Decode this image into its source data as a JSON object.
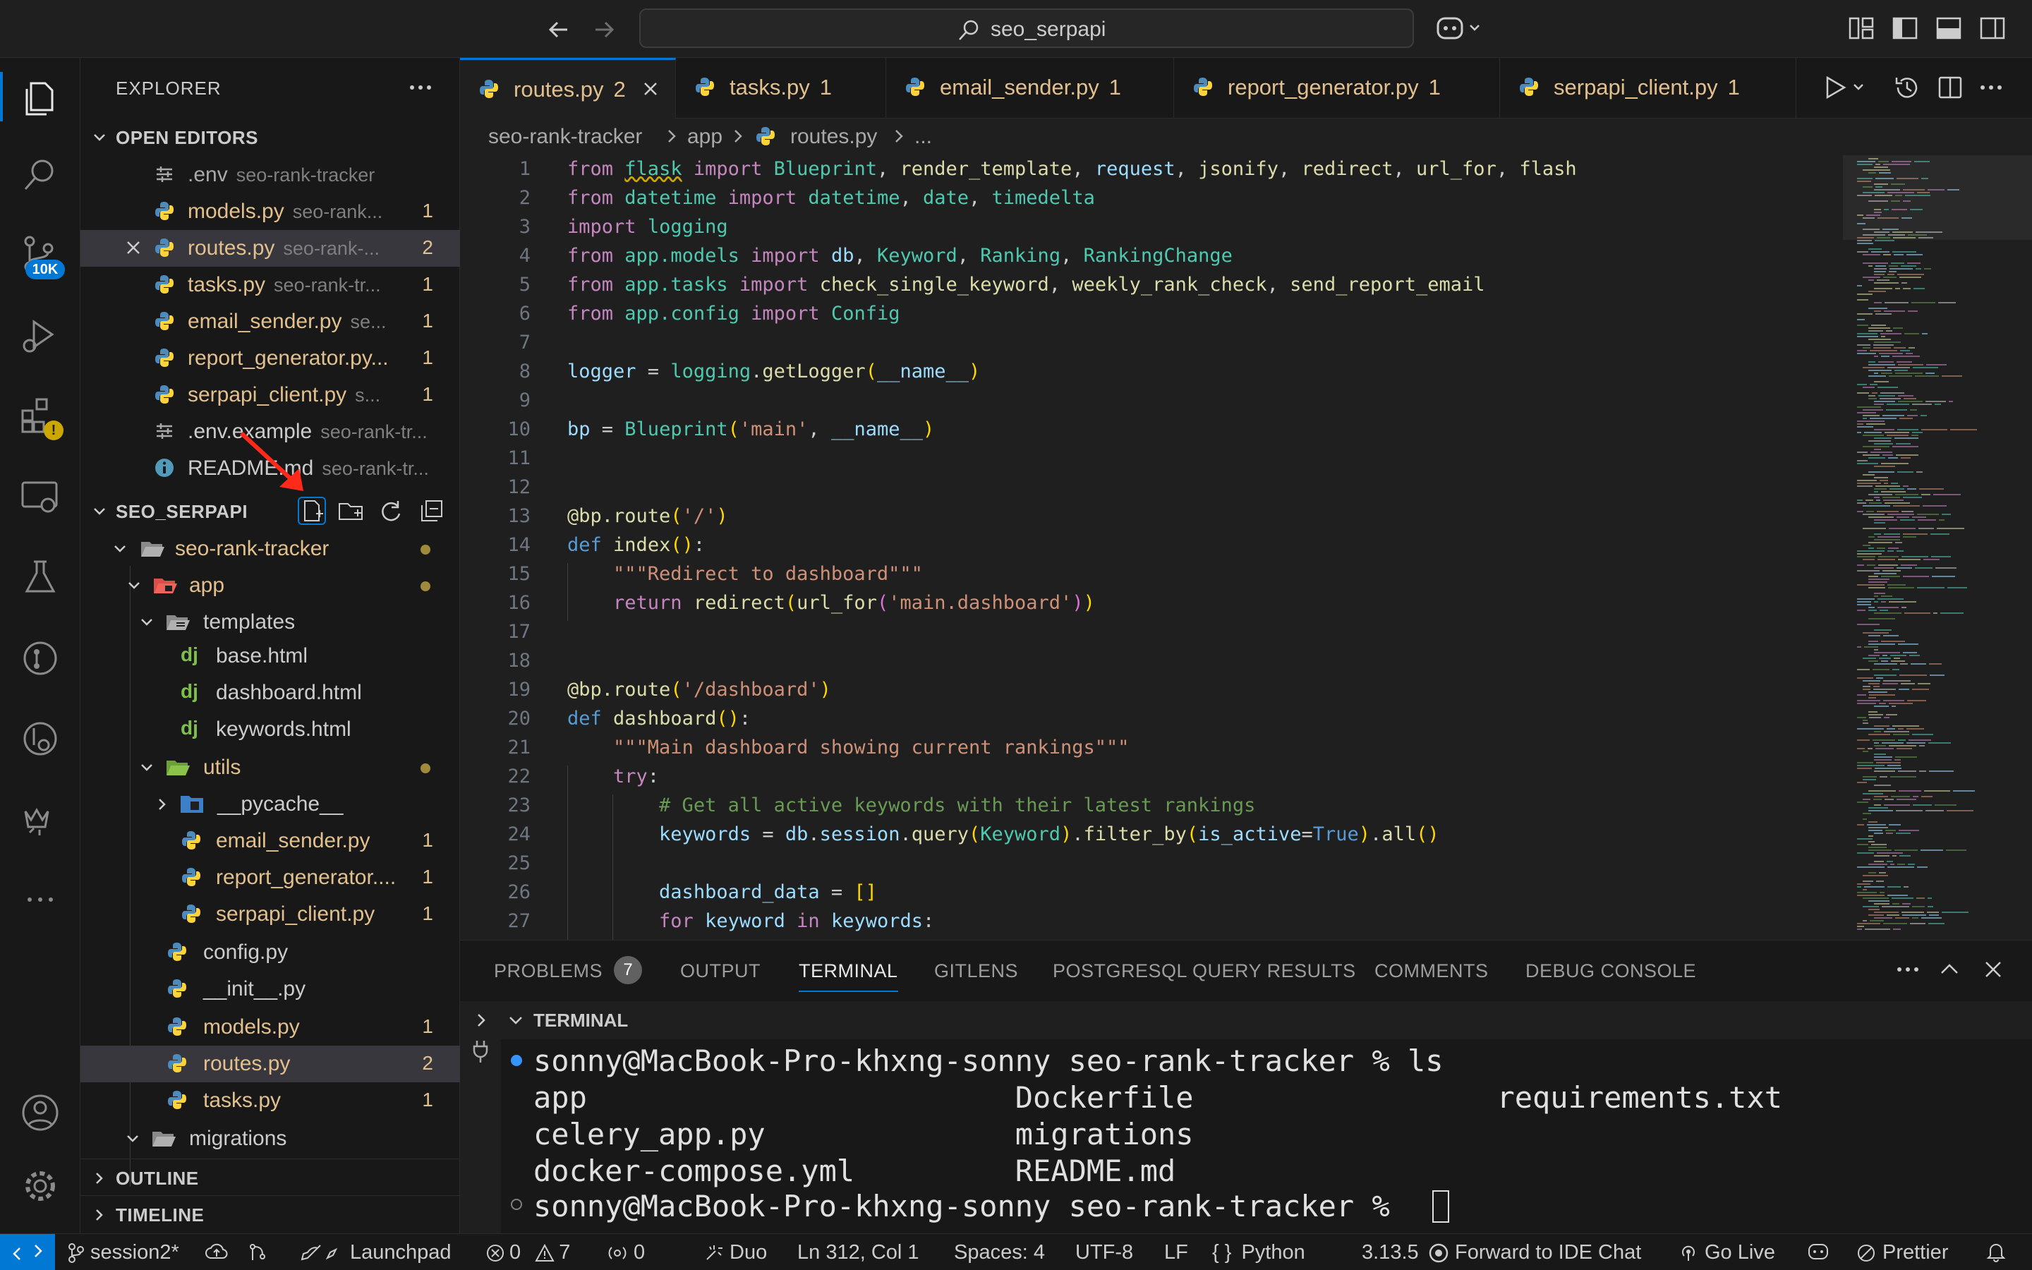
{
  "window": {
    "search_label": "seo_serpapi"
  },
  "activity_bar": {
    "source_control_badge": "10K",
    "extensions_badge": "!"
  },
  "explorer": {
    "title": "EXPLORER",
    "open_editors_label": "OPEN EDITORS",
    "open_editors": [
      {
        "name": ".env",
        "path": "seo-rank-tracker",
        "count": ""
      },
      {
        "name": "models.py",
        "path": "seo-rank...",
        "count": "1"
      },
      {
        "name": "routes.py",
        "path": "seo-rank-...",
        "count": "2"
      },
      {
        "name": "tasks.py",
        "path": "seo-rank-tr...",
        "count": "1"
      },
      {
        "name": "email_sender.py",
        "path": "se...",
        "count": "1"
      },
      {
        "name": "report_generator.py...",
        "path": "",
        "count": "1"
      },
      {
        "name": "serpapi_client.py",
        "path": "s...",
        "count": "1"
      },
      {
        "name": ".env.example",
        "path": "seo-rank-tr...",
        "count": ""
      },
      {
        "name": "README.md",
        "path": "seo-rank-tr...",
        "count": ""
      }
    ],
    "workspace_label": "SEO_SERPAPI",
    "tree": {
      "root": "seo-rank-tracker",
      "app": "app",
      "templates": "templates",
      "base_html": "base.html",
      "dashboard_html": "dashboard.html",
      "keywords_html": "keywords.html",
      "utils": "utils",
      "pycache": "__pycache__",
      "email_sender": "email_sender.py",
      "report_generator": "report_generator....",
      "serpapi_client": "serpapi_client.py",
      "config": "config.py",
      "init": "__init__.py",
      "models": "models.py",
      "routes": "routes.py",
      "tasks": "tasks.py",
      "migrations": "migrations",
      "count_1": "1",
      "count_2": "2"
    },
    "outline_label": "OUTLINE",
    "timeline_label": "TIMELINE"
  },
  "tabs": [
    {
      "name": "routes.py",
      "count": "2"
    },
    {
      "name": "tasks.py",
      "count": "1"
    },
    {
      "name": "email_sender.py",
      "count": "1"
    },
    {
      "name": "report_generator.py",
      "count": "1"
    },
    {
      "name": "serpapi_client.py",
      "count": "1"
    }
  ],
  "breadcrumb": {
    "p1": "seo-rank-tracker",
    "p2": "app",
    "p3": "routes.py",
    "p4": "..."
  },
  "code": {
    "line_numbers": [
      "1",
      "2",
      "3",
      "4",
      "5",
      "6",
      "7",
      "8",
      "9",
      "10",
      "11",
      "12",
      "13",
      "14",
      "15",
      "16",
      "17",
      "18",
      "19",
      "20",
      "21",
      "22",
      "23",
      "24",
      "25",
      "26",
      "27"
    ]
  },
  "panel": {
    "tabs": [
      "PROBLEMS",
      "OUTPUT",
      "TERMINAL",
      "GITLENS",
      "POSTGRESQL QUERY RESULTS",
      "COMMENTS",
      "DEBUG CONSOLE"
    ],
    "problems_count": "7",
    "terminal_label": "TERMINAL",
    "terminal_lines": [
      "sonny@MacBook-Pro-khxng-sonny seo-rank-tracker % ls",
      "app                        Dockerfile                 requirements.txt",
      "celery_app.py              migrations",
      "docker-compose.yml         README.md",
      "sonny@MacBook-Pro-khxng-sonny seo-rank-tracker % "
    ]
  },
  "status": {
    "branch": "session2*",
    "launchpad": "Launchpad",
    "errors": "0",
    "warnings": "7",
    "ports": "0",
    "duo": "Duo",
    "position": "Ln 312, Col 1",
    "spaces": "Spaces: 4",
    "encoding": "UTF-8",
    "eol": "LF",
    "language": "Python",
    "version": "3.13.5",
    "chat": "Forward to IDE Chat",
    "live": "Go Live",
    "prettier": "Prettier"
  },
  "colors": {
    "accent": "#0078d4",
    "modified": "#e2c08d",
    "background": "#1f1f1f",
    "sidebar": "#181818"
  }
}
